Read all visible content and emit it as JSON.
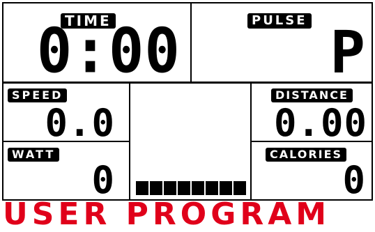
{
  "time": {
    "label": "TIME",
    "value": "0:00"
  },
  "pulse": {
    "label": "PULSE",
    "value": "P"
  },
  "speed": {
    "label": "SPEED",
    "value": "0.0"
  },
  "distance": {
    "label": "DISTANCE",
    "value": "0.00"
  },
  "watt": {
    "label": "WATT",
    "value": "0"
  },
  "calories": {
    "label": "CALORIES",
    "value": "0"
  },
  "profile": {
    "segments": 8,
    "filled_level": 1
  },
  "program": {
    "label": "USER PROGRAM",
    "color": "#e0001a"
  }
}
